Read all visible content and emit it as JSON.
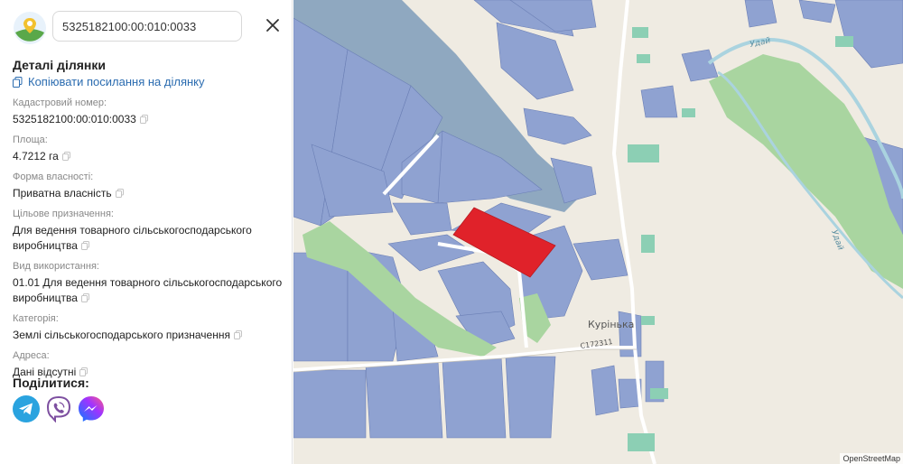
{
  "search": {
    "value": "5325182100:00:010:0033"
  },
  "details": {
    "title": "Деталі ділянки",
    "copy_link": "Копіювати посилання на ділянку",
    "fields": [
      {
        "label": "Кадастровий номер:",
        "value": "5325182100:00:010:0033"
      },
      {
        "label": "Площа:",
        "value": "4.7212 га"
      },
      {
        "label": "Форма власності:",
        "value": "Приватна власність"
      },
      {
        "label": "Цільове призначення:",
        "value": "Для ведення товарного сільськогосподарського виробництва"
      },
      {
        "label": "Вид використання:",
        "value": "01.01 Для ведення товарного сільськогосподарського виробництва"
      },
      {
        "label": "Категорія:",
        "value": "Землі сільськогосподарського призначення"
      },
      {
        "label": "Адреса:",
        "value": "Дані відсутні"
      }
    ]
  },
  "share": {
    "title": "Поділитися:"
  },
  "map": {
    "labels": {
      "river": "Удай",
      "village": "Курінька",
      "road": "С172311"
    },
    "attribution": "OpenStreetMap",
    "colors": {
      "parcel": "#8fa2d1",
      "selected": "#e0222a",
      "forest": "#a9d5a0",
      "water": "#aad3df",
      "buildings": "#8ccfb4"
    }
  },
  "icons": [
    "app-logo-icon",
    "close-icon",
    "copy-icon",
    "telegram-icon",
    "viber-icon",
    "messenger-icon"
  ]
}
